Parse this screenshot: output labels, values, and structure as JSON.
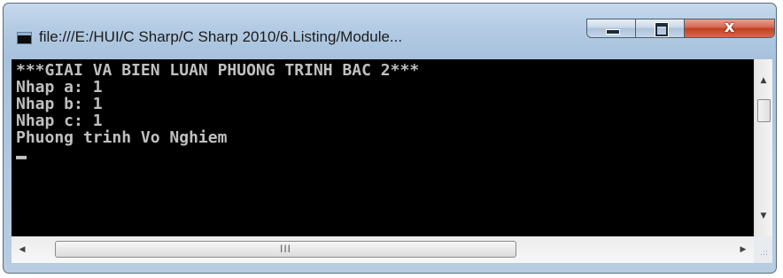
{
  "window": {
    "title": "file:///E:/HUI/C Sharp/C Sharp 2010/6.Listing/Module...",
    "close_glyph": "x"
  },
  "console": {
    "lines": [
      "***GIAI VA BIEN LUAN PHUONG TRINH BAC 2***",
      "Nhap a: 1",
      "Nhap b: 1",
      "Nhap c: 1",
      "Phuong trinh Vo Nghiem"
    ]
  },
  "scrollbars": {
    "up_arrow": "▲",
    "down_arrow": "▼",
    "left_arrow": "◀",
    "right_arrow": "▶",
    "h_thumb_grip": "III",
    "size_grip": ".::"
  },
  "icons": {
    "app": "console-app-icon",
    "minimize": "minimize-icon",
    "maximize": "maximize-icon",
    "close": "close-icon"
  },
  "colors": {
    "console_bg": "#000000",
    "console_fg": "#c0c0c0",
    "close_button": "#c2401f",
    "titlebar": "#b3cbe3"
  }
}
